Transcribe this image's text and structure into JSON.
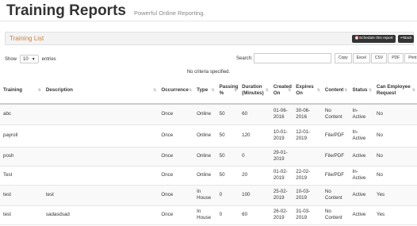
{
  "header": {
    "title": "Training Reports",
    "subtitle": "Powerful Online Reporting."
  },
  "panel": {
    "title": "Training List",
    "schedule_label": "⏰Schedule this report",
    "back_label": "↩Back"
  },
  "controls": {
    "show_label": "Show",
    "entries_value": "10",
    "entries_label": "entries",
    "search_label": "Search:",
    "search_value": ""
  },
  "export_buttons": [
    "Copy",
    "Excel",
    "CSV",
    "PDF",
    "Print"
  ],
  "no_criteria": "No criteria specified.",
  "table": {
    "columns": [
      "Training",
      "Description",
      "Occurrence",
      "Type",
      "Passing %",
      "Duration (Minutes)",
      "Created On",
      "Expires On",
      "Content",
      "Status",
      "Can Employee Request"
    ],
    "rows": [
      [
        "abc",
        "",
        "Once",
        "Online",
        "50",
        "60",
        "01-06-2016",
        "30-06-2016",
        "No Content",
        "In-Active",
        "No"
      ],
      [
        "payroll",
        "",
        "Once",
        "Online",
        "50",
        "120",
        "10-01-2019",
        "12-01-2019",
        "File/PDF",
        "In-Active",
        "No"
      ],
      [
        "posh",
        "",
        "Once",
        "Online",
        "50",
        "0",
        "29-01-2019",
        "",
        "File/PDF",
        "Active",
        "No"
      ],
      [
        "Test",
        "",
        "Once",
        "Online",
        "50",
        "20",
        "01-02-2019",
        "22-02-2019",
        "File/PDF",
        "In-Active",
        "No"
      ],
      [
        "test",
        "test",
        "Once",
        "In House",
        "0",
        "100",
        "25-02-2019",
        "10-03-2019",
        "No Content",
        "Active",
        "Yes"
      ],
      [
        "test",
        "sadasdsad",
        "Once",
        "In House",
        "0",
        "60",
        "26-02-2019",
        "31-03-2019",
        "No Content",
        "Active",
        "Yes"
      ]
    ]
  }
}
